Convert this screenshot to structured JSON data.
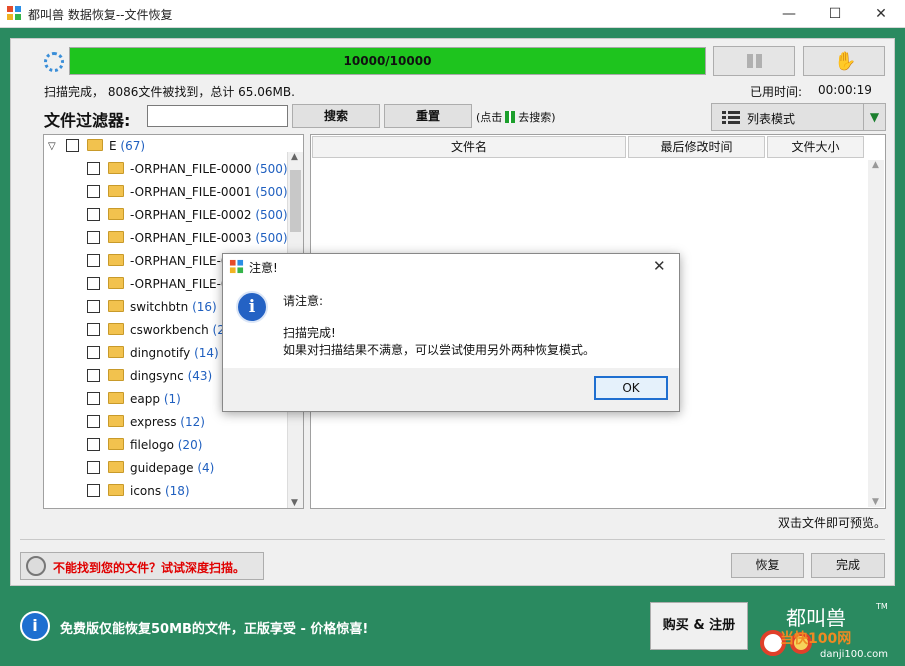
{
  "window": {
    "title": "都叫兽 数据恢复--文件恢复",
    "minimize": "—",
    "maximize": "☐",
    "close": "✕"
  },
  "scan": {
    "progress_text": "10000/10000",
    "progress_fraction": 1.0,
    "status": "扫描完成， 8086文件被找到，总计 65.06MB.",
    "elapsed_label": "已用时间:",
    "elapsed_value": "00:00:19",
    "progress_color": "#1ec41e"
  },
  "filter": {
    "label": "文件过滤器:",
    "input_value": "",
    "search_label": "搜索",
    "reset_label": "重置",
    "hint_prefix": "(点击",
    "hint_suffix": "去搜索)"
  },
  "view_mode": {
    "label": "列表模式",
    "drop": "▼"
  },
  "tree": {
    "root": {
      "caret": "▽",
      "name": "E",
      "count": "(67)"
    },
    "items": [
      {
        "name": "-ORPHAN_FILE-0000",
        "count": "(500)"
      },
      {
        "name": "-ORPHAN_FILE-0001",
        "count": "(500)"
      },
      {
        "name": "-ORPHAN_FILE-0002",
        "count": "(500)"
      },
      {
        "name": "-ORPHAN_FILE-0003",
        "count": "(500)"
      },
      {
        "name": "-ORPHAN_FILE-0",
        "count": ""
      },
      {
        "name": "-ORPHAN_FILE-0",
        "count": ""
      },
      {
        "name": "switchbtn",
        "count": "(16)"
      },
      {
        "name": "csworkbench",
        "count": "(28"
      },
      {
        "name": "dingnotify",
        "count": "(14)"
      },
      {
        "name": "dingsync",
        "count": "(43)"
      },
      {
        "name": "eapp",
        "count": "(1)"
      },
      {
        "name": "express",
        "count": "(12)"
      },
      {
        "name": "filelogo",
        "count": "(20)"
      },
      {
        "name": "guidepage",
        "count": "(4)"
      },
      {
        "name": "icons",
        "count": "(18)"
      }
    ]
  },
  "filelist": {
    "col_name": "文件名",
    "col_mtime": "最后修改时间",
    "col_size": "文件大小"
  },
  "preview_hint": "双击文件即可预览。",
  "deep_scan_label": "不能找到您的文件？试试深度扫描。",
  "buttons": {
    "recover": "恢复",
    "done": "完成",
    "buy": "购买 & 注册"
  },
  "promo": {
    "text": "免费版仅能恢复50MB的文件，正版享受 - 价格惊喜!"
  },
  "logo": {
    "brand": "都叫兽",
    "tm": "TM",
    "watermark": "当快100网",
    "watermark_url": "danji100.com"
  },
  "dialog": {
    "title": "注意!",
    "line1": "请注意:",
    "line2": "扫描完成!",
    "line3": "如果对扫描结果不满意，可以尝试使用另外两种恢复模式。",
    "ok": "OK",
    "close": "✕",
    "info": "i"
  }
}
